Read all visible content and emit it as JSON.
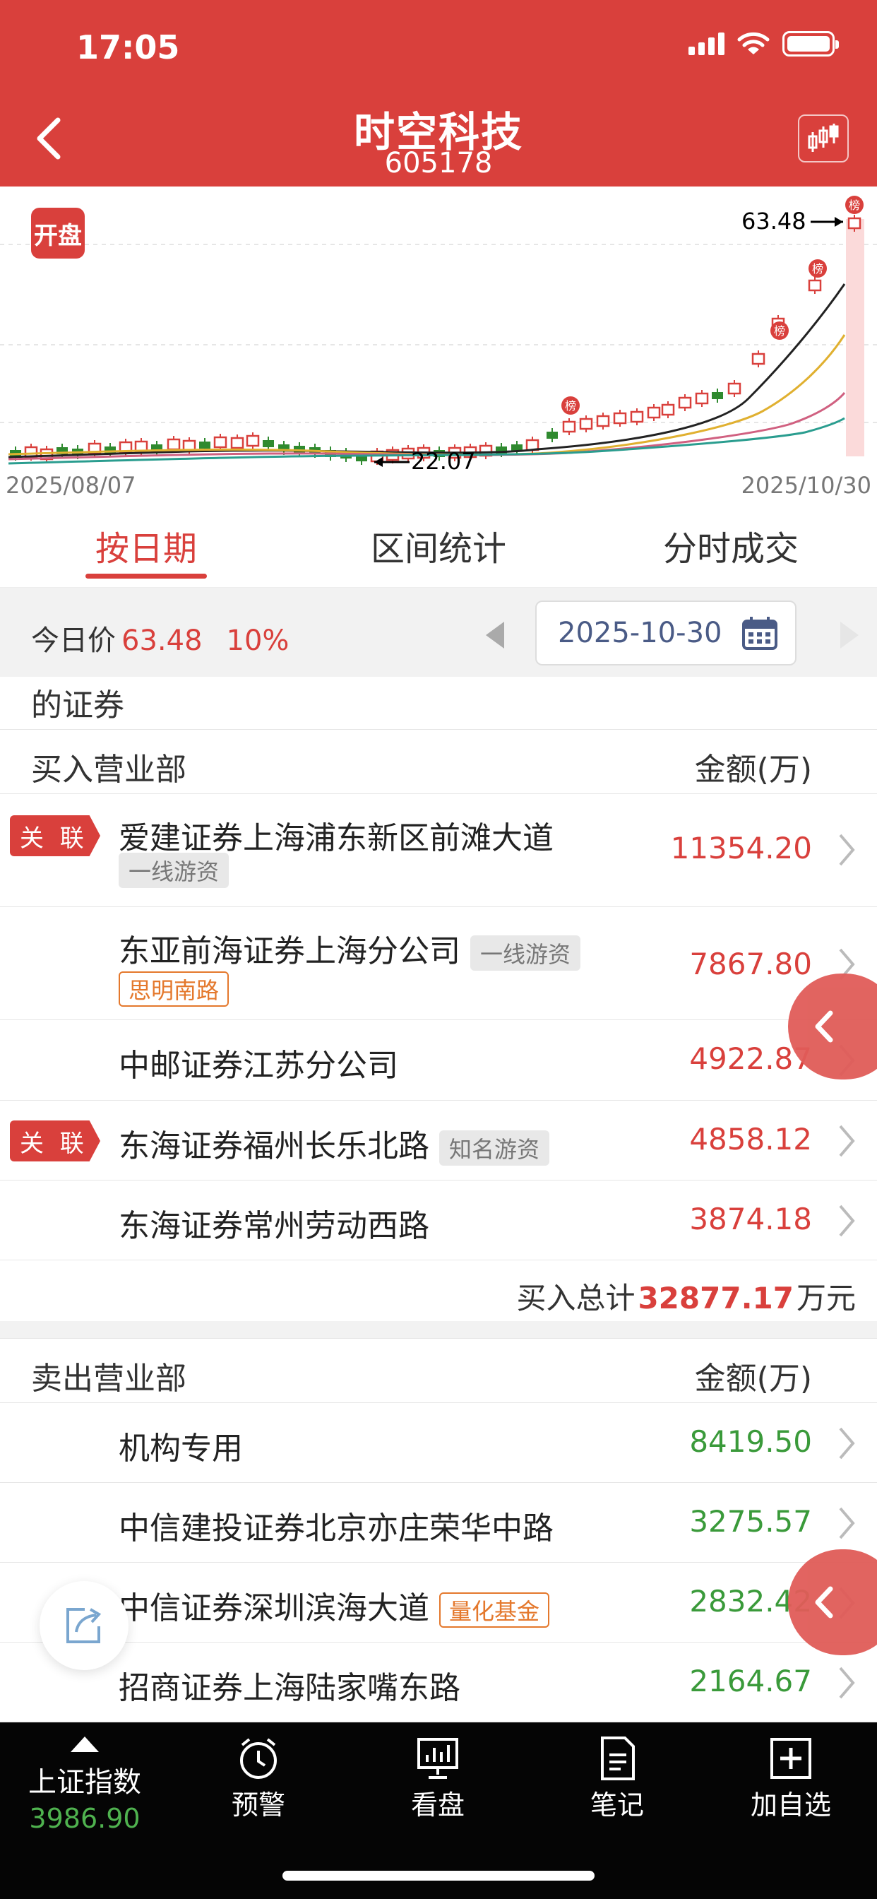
{
  "status_bar": {
    "time": "17:05"
  },
  "header": {
    "title": "时空科技",
    "code": "605178"
  },
  "chart": {
    "badge": "开盘",
    "date_start": "2025/08/07",
    "date_end": "2025/10/30",
    "high_label": "63.48",
    "low_label": "22.07",
    "list_marker": "榜"
  },
  "tabs": [
    "按日期",
    "区间统计",
    "分时成交"
  ],
  "price_bar": {
    "label": "今日价",
    "price": "63.48",
    "pct": "10%",
    "date": "2025-10-30"
  },
  "partial_text": "的证券",
  "buy_section": {
    "title": "买入营业部",
    "amount_header": "金额(万)",
    "relation_tag": "关 联",
    "rows": [
      {
        "name": "爱建证券上海浦东新区前滩大道",
        "tag": "一线游资",
        "amount": "11354.20"
      },
      {
        "name": "东亚前海证券上海分公司",
        "tag": "一线游资",
        "tag2": "思明南路",
        "amount": "7867.80"
      },
      {
        "name": "中邮证券江苏分公司",
        "amount": "4922.87"
      },
      {
        "name": "东海证券福州长乐北路",
        "tag": "知名游资",
        "amount": "4858.12"
      },
      {
        "name": "东海证券常州劳动西路",
        "amount": "3874.18"
      }
    ],
    "total_label": "买入总计",
    "total_value": "32877.17",
    "total_unit": "万元"
  },
  "sell_section": {
    "title": "卖出营业部",
    "amount_header": "金额(万)",
    "rows": [
      {
        "name": "机构专用",
        "amount": "8419.50"
      },
      {
        "name": "中信建投证券北京亦庄荣华中路",
        "amount": "3275.57"
      },
      {
        "name": "中信证券深圳滨海大道",
        "tag": "量化基金",
        "amount": "2832.42"
      },
      {
        "name": "招商证券上海陆家嘴东路",
        "amount": "2164.67"
      }
    ]
  },
  "tab_bar": {
    "index_name": "上证指数",
    "index_value": "3986.90",
    "items": [
      "预警",
      "看盘",
      "笔记",
      "加自选"
    ]
  },
  "colors": {
    "brand_red": "#d9403c",
    "up": "#d9403c",
    "down": "#3a9a3a"
  }
}
